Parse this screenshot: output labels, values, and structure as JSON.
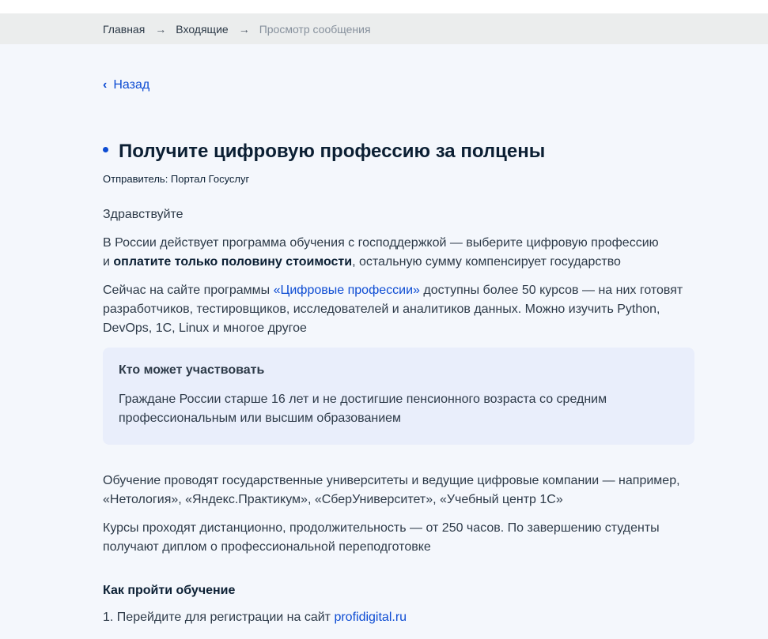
{
  "breadcrumbs": {
    "home": "Главная",
    "inbox": "Входящие",
    "current": "Просмотр сообщения",
    "separator": "→"
  },
  "back": {
    "label": "Назад",
    "icon": "‹"
  },
  "message": {
    "title": "Получите цифровую профессию за полцены",
    "sender": "Отправитель: Портал Госуслуг",
    "greeting": "Здравствуйте",
    "p1_line1": "В России действует программа обучения с господдержкой — выберите цифровую профессию",
    "p1_prefix": "и ",
    "p1_bold": "оплатите только половину стоимости",
    "p1_suffix": ", остальную сумму компенсирует государство",
    "p2_prefix": "Сейчас на сайте программы ",
    "p2_link": "«Цифровые профессии»",
    "p2_line1_suffix": " доступны более 50 курсов — на них готовят",
    "p2_line2": "разработчиков, тестировщиков, исследователей и аналитиков данных. Можно изучить Python,",
    "p2_line3": "DevOps, 1С, Linux и многое другое",
    "info_title": "Кто может участвовать",
    "info_line1": "Граждане России старше 16 лет и не достигшие пенсионного возраста со средним",
    "info_line2": "профессиональным или высшим образованием",
    "p3_line1": "Обучение проводят государственные университеты и ведущие цифровые компании — например,",
    "p3_line2": "«Нетология», «Яндекс.Практикум», «СберУниверситет», «Учебный центр 1С»",
    "p4_line1": "Курсы проходят дистанционно, продолжительность — от 250 часов. По завершению студенты",
    "p4_line2": "получают диплом о профессиональной переподготовке",
    "how_title": "Как пройти обучение",
    "step1_prefix": "1. Перейдите для регистрации на сайт ",
    "step1_link": "profidigital.ru"
  },
  "colors": {
    "accent": "#0d4cd3",
    "text": "#0b1f33",
    "page_bg": "#f4f7fc",
    "info_bg": "#e9eefb"
  }
}
